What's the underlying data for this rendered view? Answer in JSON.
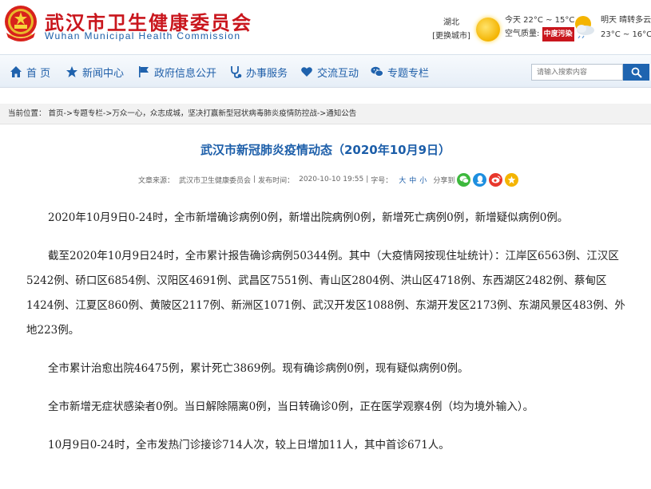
{
  "header": {
    "title": "武汉市卫生健康委员会",
    "subtitle": "Wuhan Municipal Health Commission",
    "location": "湖北",
    "change_city": "[更换城市]",
    "today": "今天  22°C ~ 15°C",
    "air_quality_label": "空气质量:",
    "air_quality_value": "中度污染",
    "tomorrow": "明天  晴转多云",
    "tomorrow_temp": "23°C ~ 16°C"
  },
  "nav": {
    "items": [
      {
        "label": "首 页",
        "icon": "home-icon"
      },
      {
        "label": "新闻中心",
        "icon": "star-icon"
      },
      {
        "label": "政府信息公开",
        "icon": "flag-icon"
      },
      {
        "label": "办事服务",
        "icon": "stethoscope-icon"
      },
      {
        "label": "交流互动",
        "icon": "heart-icon"
      },
      {
        "label": "专题专栏",
        "icon": "chat-icon"
      }
    ],
    "search_placeholder": "请输入搜索内容"
  },
  "breadcrumb": {
    "label": "当前位置：",
    "path": "首页->专题专栏->万众一心，众志成城，坚决打赢新型冠状病毒肺炎疫情防控战->通知公告"
  },
  "article": {
    "title": "武汉市新冠肺炎疫情动态（2020年10月9日）",
    "source_label": "文章来源：",
    "source": "武汉市卫生健康委员会",
    "publish_label": "发布时间：",
    "publish_time": "2020-10-10 19:55",
    "font_label": "字号：",
    "font_large": "大",
    "font_medium": "中",
    "font_small": "小",
    "share_label": "分享到",
    "paragraphs": [
      "2020年10月9日0-24时，全市新增确诊病例0例，新增出院病例0例，新增死亡病例0例，新增疑似病例0例。",
      "截至2020年10月9日24时，全市累计报告确诊病例50344例。其中（大疫情网按现住址统计）：江岸区6563例、江汉区5242例、硚口区6854例、汉阳区4691例、武昌区7551例、青山区2804例、洪山区4718例、东西湖区2482例、蔡甸区1424例、江夏区860例、黄陂区2117例、新洲区1071例、武汉开发区1088例、东湖开发区2173例、东湖风景区483例、外地223例。",
      "全市累计治愈出院46475例，累计死亡3869例。现有确诊病例0例，现有疑似病例0例。",
      "全市新增无症状感染者0例。当日解除隔离0例，当日转确诊0例，正在医学观察4例（均为境外输入）。",
      "10月9日0-24时，全市发热门诊接诊714人次，较上日增加11人，其中首诊671人。"
    ]
  }
}
